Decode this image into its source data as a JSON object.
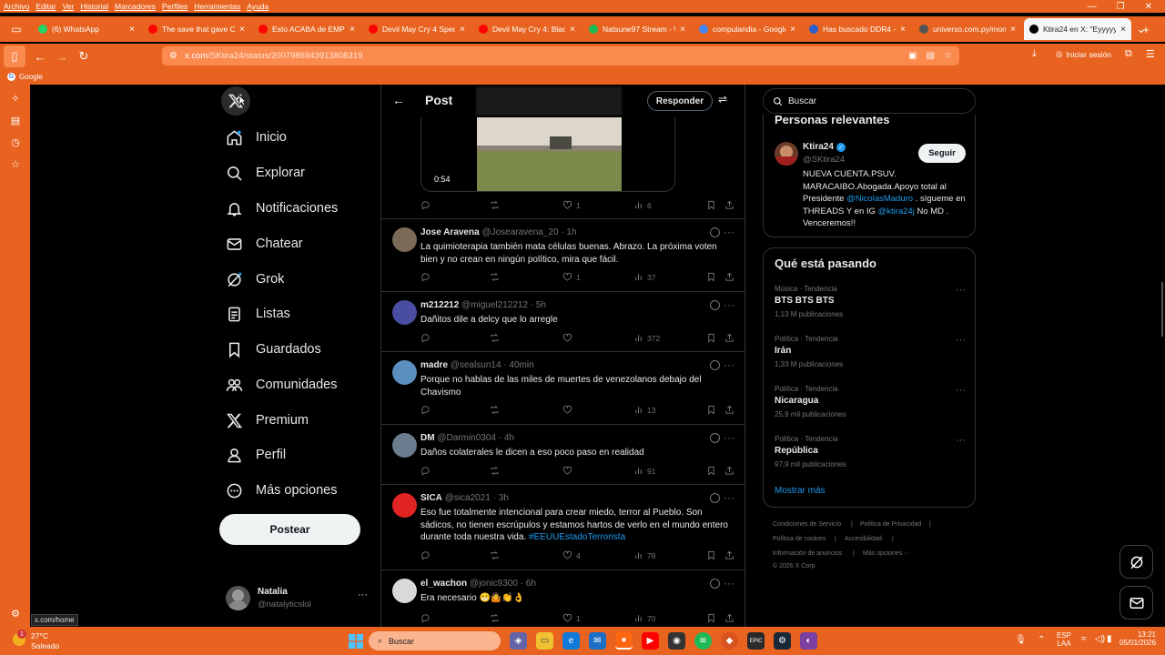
{
  "menubar": {
    "items": [
      "Archivo",
      "Editar",
      "Ver",
      "Historial",
      "Marcadores",
      "Perfiles",
      "Herramientas",
      "Ayuda"
    ]
  },
  "tabs": [
    {
      "title": "(6) WhatsApp",
      "color": "#25d366"
    },
    {
      "title": "The save that gave City",
      "color": "#ff0000"
    },
    {
      "title": "Esto ACABA de EMPEZAR",
      "color": "#ff0000"
    },
    {
      "title": "Devil May Cry 4 Special",
      "color": "#ff0000"
    },
    {
      "title": "Devil May Cry 4: Blacke",
      "color": "#ff0000"
    },
    {
      "title": "Natsune97 Stream - W",
      "color": "#1db954"
    },
    {
      "title": "compulandia - Google",
      "color": "#4285f4"
    },
    {
      "title": "Has buscado DDR4 - P",
      "color": "#2d5ec9"
    },
    {
      "title": "universo.com.py/monit",
      "color": "#555555"
    },
    {
      "title": "Ktira24 en X: \"Eyyyyy 1",
      "color": "#000000"
    }
  ],
  "address_bar": {
    "url_domain": "x.com",
    "url_path": "/SKtira24/status/2007986943913808319",
    "signin_label": "Iniciar sesión"
  },
  "bookmarks": {
    "item": "Google"
  },
  "status_link": "x.com/home",
  "nav": {
    "items": [
      "Inicio",
      "Explorar",
      "Notificaciones",
      "Chatear",
      "Grok",
      "Listas",
      "Guardados",
      "Comunidades",
      "Premium",
      "Perfil",
      "Más opciones"
    ],
    "post_button": "Postear",
    "user": {
      "name": "Natalia",
      "handle": "@natalyticslol"
    }
  },
  "header": {
    "title": "Post",
    "reply_button": "Responder"
  },
  "media": {
    "duration": "0:54",
    "stats": {
      "likes": "1",
      "views": "6"
    }
  },
  "tweets": [
    {
      "name": "Jose Aravena",
      "handle": "@Josearavena_20 · 1h",
      "text": "La quimioterapia también mata células buenas. Abrazo. La próxima voten bien y no crean en ningún político, mira que fácil.",
      "likes": "1",
      "views": "37",
      "avatar": "#7a6a56"
    },
    {
      "name": "m212212",
      "handle": "@miguel212212 · 5h",
      "text": "Dañitos  dile a delcy que lo arregle",
      "likes": "",
      "views": "372",
      "avatar": "#4a4ea0"
    },
    {
      "name": "madre",
      "handle": "@sealsun14 · 40min",
      "text": "Porque no hablas de las miles de muertes de venezolanos debajo del Chavismo",
      "likes": "",
      "views": "13",
      "avatar": "#5a8fbf"
    },
    {
      "name": "DM",
      "handle": "@Darmin0304 · 4h",
      "text": "Daños colaterales le dicen a eso poco paso en realidad",
      "likes": "",
      "views": "91",
      "avatar": "#6b7c8e"
    },
    {
      "name": "SICA",
      "handle": "@sica2021 · 3h",
      "text": "Eso fue totalmente intencional para crear miedo, terror al Pueblo. Son sádicos, no tienen escrúpulos y estamos hartos de verlo en el mundo entero durante toda nuestra vida.",
      "hashtag": "#EEUUEstadoTerrorista",
      "likes": "4",
      "views": "78",
      "avatar": "#e02424"
    },
    {
      "name": "el_wachon",
      "handle": "@jonic9300 · 6h",
      "text": "Era necesario 😬🤷👏👌",
      "likes": "1",
      "views": "70",
      "avatar": "#d9d9d9"
    }
  ],
  "search": {
    "placeholder": "Buscar"
  },
  "relevant": {
    "title": "Personas relevantes",
    "name": "Ktira24",
    "handle": "@SKtira24",
    "follow": "Seguir",
    "bio_1": "NUEVA CUENTA.PSUV. MARACAIBO.Abogada.Apoyo total al Presidente ",
    "bio_mention1": "@NicolasMaduro",
    "bio_2": " . sígueme en THREADS Y en IG ",
    "bio_mention2": "@ktira24j",
    "bio_3": " No MD . Venceremos!!"
  },
  "trends": {
    "title": "Qué está pasando",
    "items": [
      {
        "cat": "Música · Tendencia",
        "name": "BTS BTS BTS",
        "count": "1,13 M publicaciones"
      },
      {
        "cat": "Política · Tendencia",
        "name": "Irán",
        "count": "1,33 M publicaciones"
      },
      {
        "cat": "Política · Tendencia",
        "name": "Nicaragua",
        "count": "25,9 mil publicaciones"
      },
      {
        "cat": "Política · Tendencia",
        "name": "República",
        "count": "97,9 mil publicaciones"
      }
    ],
    "show_more": "Mostrar más"
  },
  "footer": {
    "terms": "Condiciones de Servicio",
    "privacy": "Política de Privacidad",
    "cookies": "Política de cookies",
    "access": "Accesibilidad",
    "ads": "Información de anuncios",
    "more": "Más opciones ···",
    "copy": "© 2026 X Corp."
  },
  "taskbar": {
    "temp": "27°C",
    "weather": "Soleado",
    "search": "Buscar",
    "lang1": "ESP",
    "lang2": "LAA",
    "time": "13:21",
    "date": "05/01/2026",
    "badge": "1"
  }
}
